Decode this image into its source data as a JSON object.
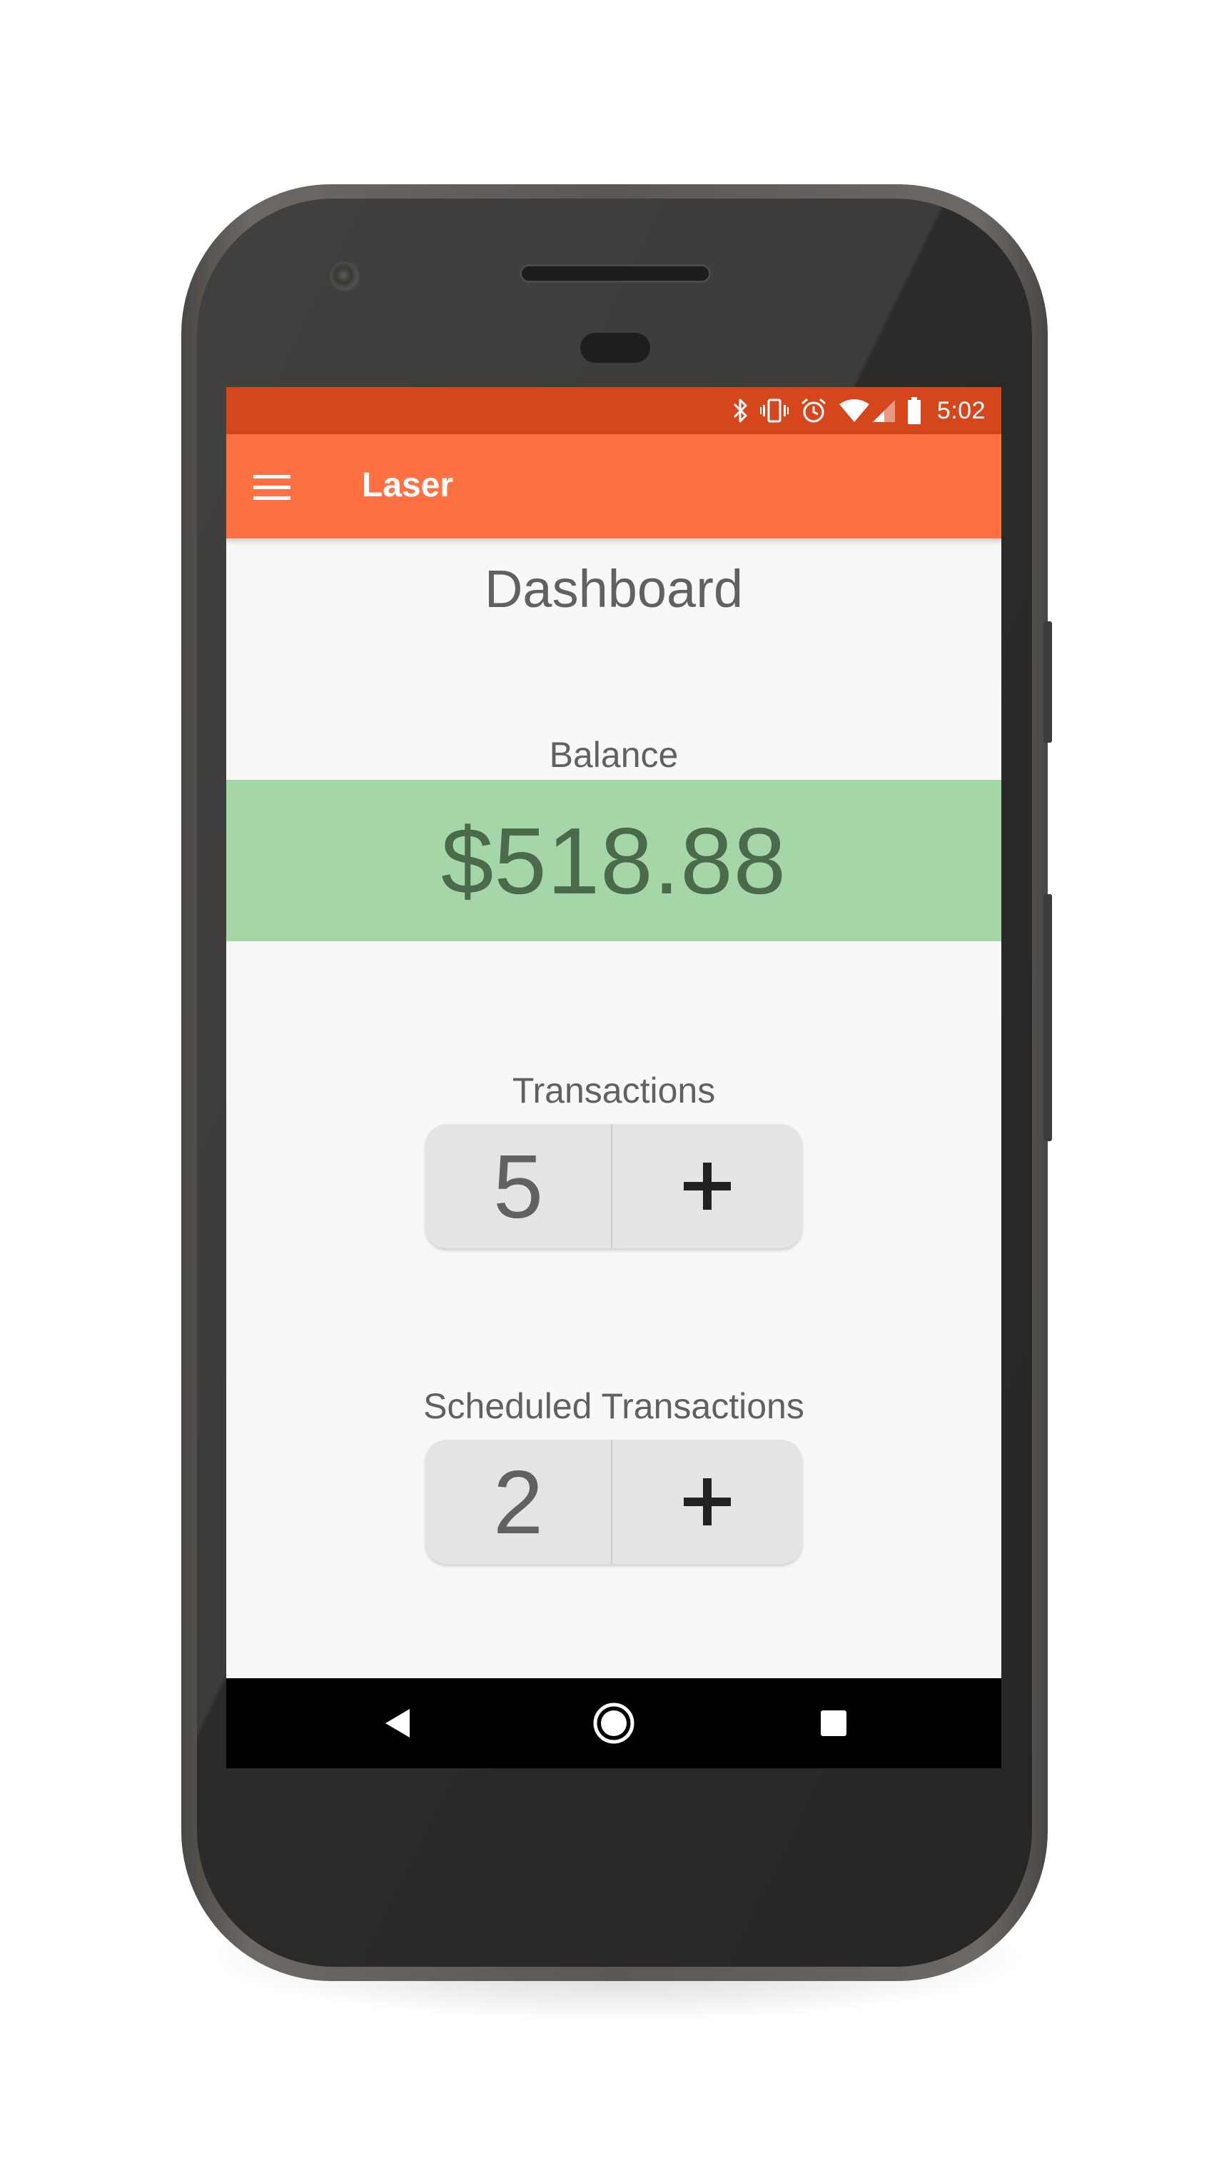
{
  "status_bar": {
    "time": "5:02",
    "icons": [
      "bluetooth-icon",
      "vibrate-icon",
      "alarm-icon",
      "wifi-icon",
      "signal-icon",
      "battery-icon"
    ],
    "color": "#d6461d"
  },
  "app_bar": {
    "title": "Laser",
    "menu_icon": "hamburger-menu-icon",
    "color": "#ff7043"
  },
  "dashboard": {
    "title": "Dashboard",
    "balance": {
      "label": "Balance",
      "value": "$518.88",
      "color": "#a5d6a7"
    },
    "transactions": {
      "label": "Transactions",
      "count": "5",
      "add_label": "+"
    },
    "scheduled_transactions": {
      "label": "Scheduled Transactions",
      "count": "2",
      "add_label": "+"
    }
  },
  "nav_bar": {
    "icons": [
      "back-icon",
      "home-icon",
      "recents-icon"
    ]
  }
}
